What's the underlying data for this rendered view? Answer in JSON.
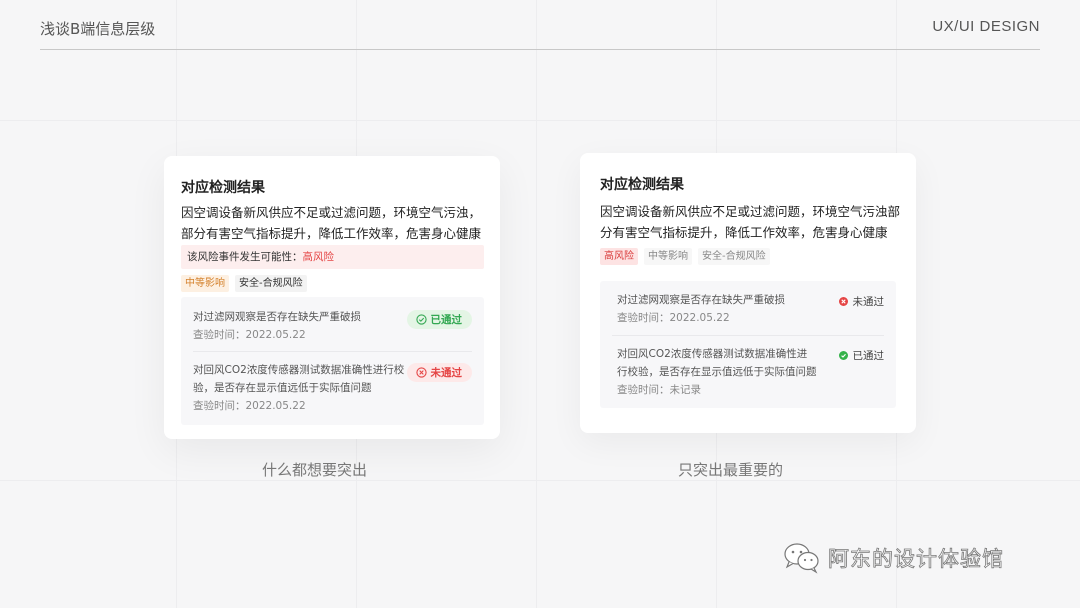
{
  "header": {
    "title": "浅谈B端信息层级",
    "brand": "UX/UI DESIGN"
  },
  "card_a": {
    "title": "对应检测结果",
    "desc": "因空调设备新风供应不足或过滤问题，环境空气污浊，部分有害空气指标提升，降低工作效率，危害身心健康",
    "risk_label": "该风险事件发生可能性：",
    "risk_value": "高风险",
    "tags": [
      "中等影响",
      "安全-合规风险"
    ],
    "checks": [
      {
        "name": "对过滤网观察是否存在缺失严重破损",
        "time": "查验时间：2022.05.22",
        "status": "已通过"
      },
      {
        "name": "对回风CO2浓度传感器测试数据准确性进行校验，是否存在显示值远低于实际值问题",
        "time": "查验时间：2022.05.22",
        "status": "未通过"
      }
    ]
  },
  "card_b": {
    "title": "对应检测结果",
    "desc": "因空调设备新风供应不足或过滤问题，环境空气污浊部分有害空气指标提升，降低工作效率，危害身心健康",
    "tags": [
      "高风险",
      "中等影响",
      "安全-合规风险"
    ],
    "checks": [
      {
        "name": "对过滤网观察是否存在缺失严重破损",
        "time": "查验时间：2022.05.22",
        "status": "未通过"
      },
      {
        "name": "对回风CO2浓度传感器测试数据准确性进行校验，是否存在显示值远低于实际值问题",
        "time": "查验时间：未记录",
        "status": "已通过"
      }
    ]
  },
  "captions": {
    "left": "什么都想要突出",
    "right": "只突出最重要的"
  },
  "watermark": {
    "text": "阿东的设计体验馆",
    "icon": "wechat-icon"
  },
  "colors": {
    "pass": "#34a853",
    "fail": "#e54545",
    "orange": "#d4812c"
  }
}
